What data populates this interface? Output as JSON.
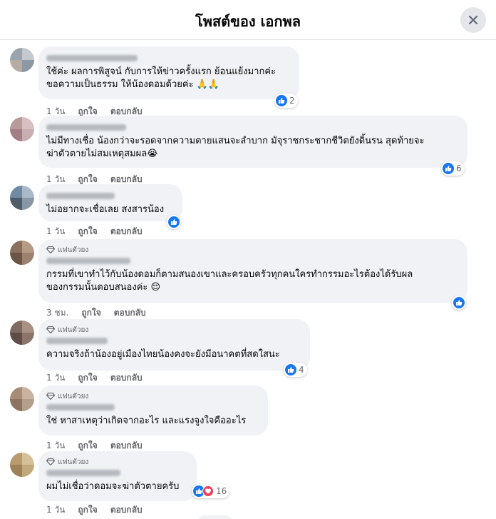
{
  "header": {
    "title": "โพสต์ของ เอกพล"
  },
  "comments": [
    {
      "fan_label": "",
      "text": "ใช้ค่ะ ผลการพิสูจน์ กับการให้ข่าวครั้งแรก ย้อนแย้งมากค่ะ\nขอความเป็นธรรม ให้น้องดอมด้วยค่ะ 🙏🙏",
      "time": "1 วัน",
      "like": "ถูกใจ",
      "reply": "ตอบกลับ",
      "reaction_count": "2"
    },
    {
      "fan_label": "",
      "text": "ไม่มีทางเชื่อ น้องกว่าจะรอดจากความตายแสนจะลำบาก มัจุราชกระชากชีวิตยังดิ้นรน สุดท้ายจะ\nฆ่าตัวตายไม่สมเหตุสมผล😭",
      "time": "1 วัน",
      "like": "ถูกใจ",
      "reply": "ตอบกลับ",
      "reaction_count": "6"
    },
    {
      "fan_label": "",
      "text": "ไม่อยากจะเชื่อเลย สงสารน้อง",
      "time": "1 วัน",
      "like": "ถูกใจ",
      "reply": "ตอบกลับ",
      "reaction_count": ""
    },
    {
      "fan_label": "แฟนตัวยง",
      "text": "กรรมที่เขาทำไว้กับน้องดอมก็ตามสนองเขาและครอบครัวทุกคนใครทำกรรมอะไรต้องได้รับผล\nของกรรมนั้นตอบสนองค่ะ 😌",
      "time": "3 ชม.",
      "like": "ถูกใจ",
      "reply": "ตอบกลับ",
      "reaction_count": ""
    },
    {
      "fan_label": "แฟนตัวยง",
      "text": "ความจริงถ้าน้องอยู่เมืองไทยน้องคงจะยังมีอนาคตที่สดใสนะ",
      "time": "1 วัน",
      "like": "ถูกใจ",
      "reply": "ตอบกลับ",
      "reaction_count": "4"
    },
    {
      "fan_label": "แฟนตัวยง",
      "text": "ใช่ หาสาเหตุว่าเกิดจากอะไร และแรงจูงใจคืออะไร",
      "time": "1 วัน",
      "like": "ถูกใจ",
      "reply": "ตอบกลับ",
      "reaction_count": ""
    },
    {
      "fan_label": "แฟนตัวยง",
      "text": "ผมไม่เชื่อว่าดอมจะฆ่าตัวตายครับ",
      "time": "1 วัน",
      "like": "ถูกใจ",
      "reply": "ตอบกลับ",
      "reaction_count": "16"
    }
  ],
  "colors": {
    "accent": "#1877f2",
    "love": "#f33e58",
    "bubble": "#f0f2f5",
    "meta": "#65676b"
  },
  "icons": {
    "close": "close-icon",
    "like": "like-icon",
    "love": "love-icon",
    "fan": "diamond-icon"
  }
}
